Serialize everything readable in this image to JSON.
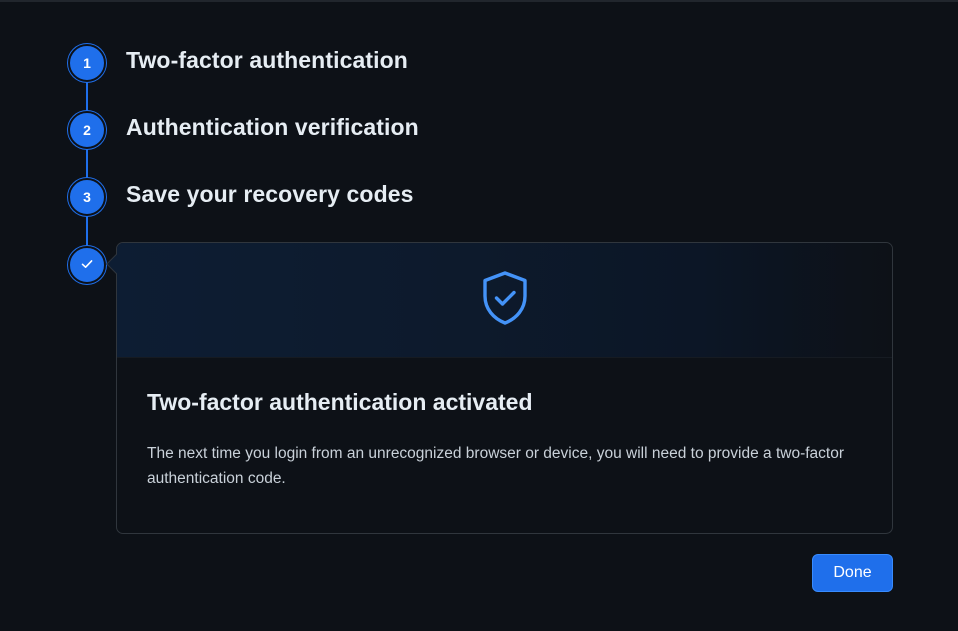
{
  "steps": [
    {
      "number": "1",
      "title": "Two-factor authentication"
    },
    {
      "number": "2",
      "title": "Authentication verification"
    },
    {
      "number": "3",
      "title": "Save your recovery codes"
    }
  ],
  "final_step": {
    "icon": "check-icon",
    "card": {
      "banner_icon": "shield-check-icon",
      "title": "Two-factor authentication activated",
      "body": "The next time you login from an unrecognized browser or device, you will need to provide a two-factor authentication code."
    }
  },
  "actions": {
    "done_label": "Done"
  },
  "colors": {
    "background": "#0d1117",
    "accent": "#1f6feb",
    "border": "#30363d",
    "text": "#e6edf3",
    "muted_text": "#c9d1d9",
    "shield": "#4493f8"
  }
}
